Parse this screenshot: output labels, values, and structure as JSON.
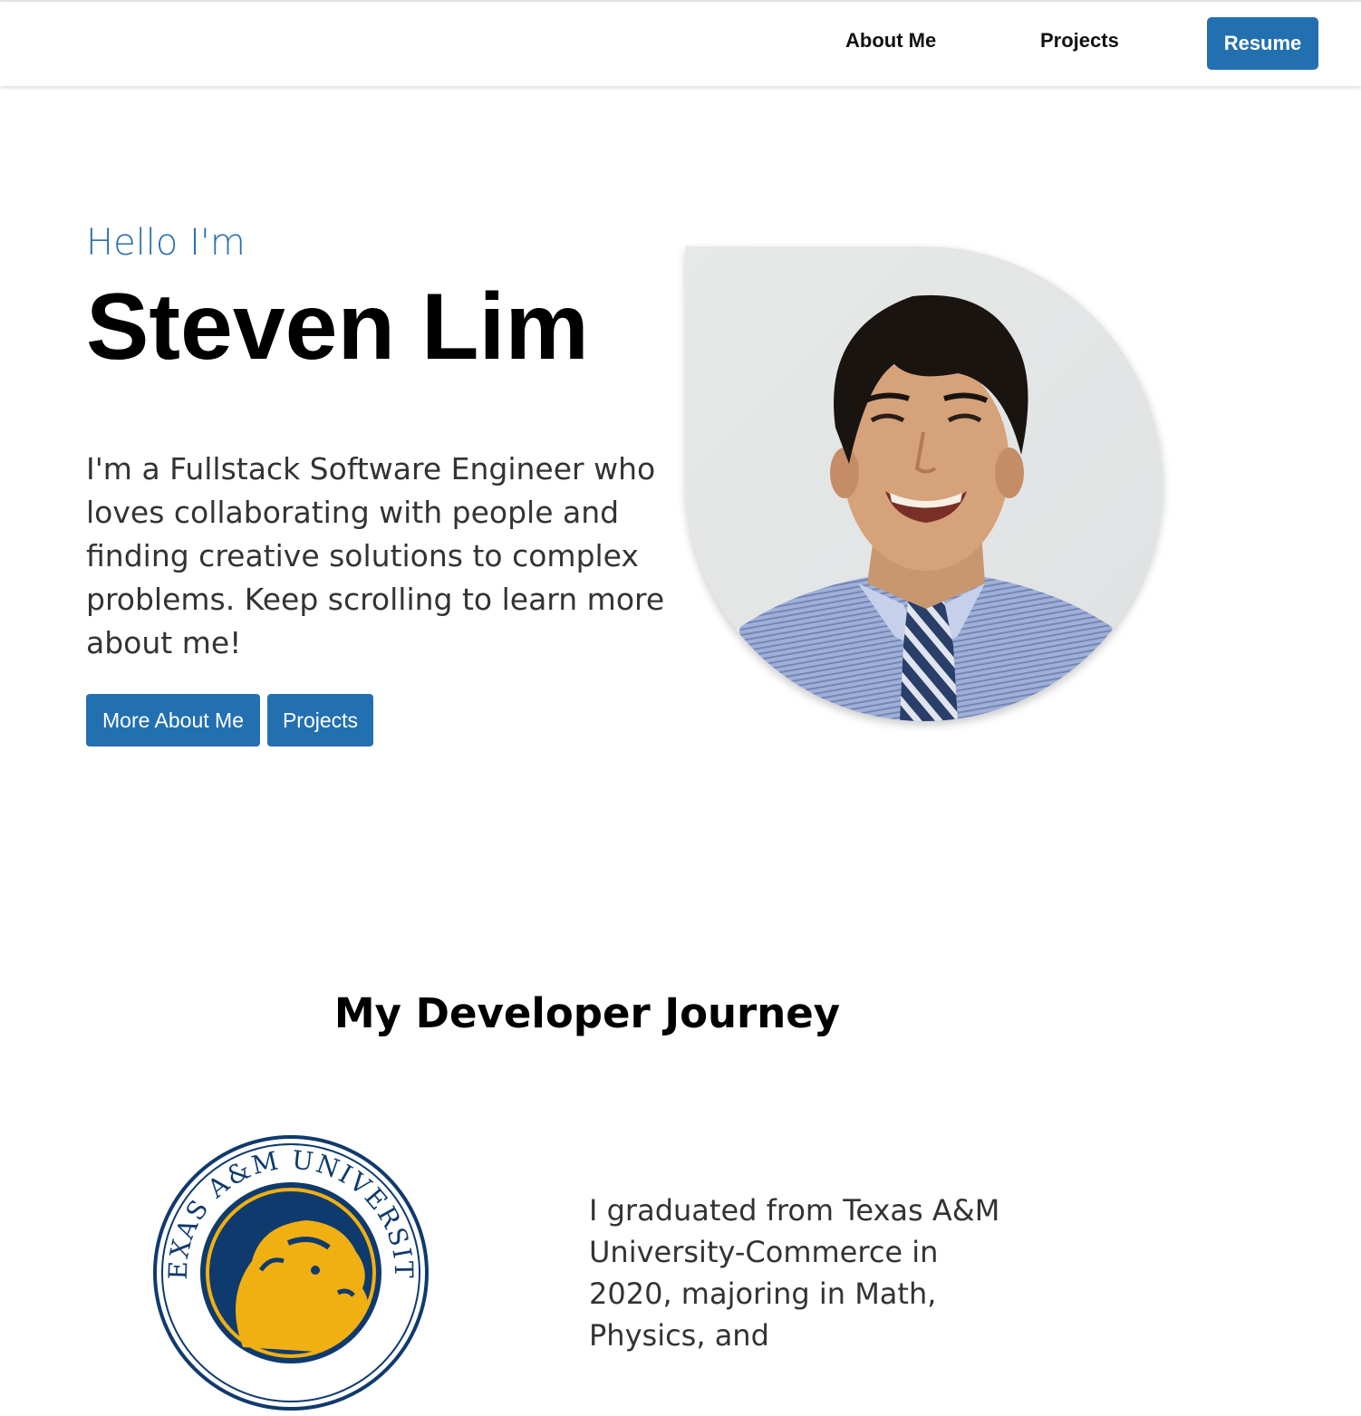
{
  "nav": {
    "about": "About Me",
    "projects": "Projects",
    "resume": "Resume"
  },
  "hero": {
    "greeting": "Hello I'm",
    "name": "Steven Lim",
    "intro": "I'm a Fullstack Software Engineer who loves collaborating with people and finding creative solutions to complex problems. Keep scrolling to learn more about me!",
    "buttons": {
      "more": "More About Me",
      "projects": "Projects"
    }
  },
  "journey": {
    "title": "My Developer Journey",
    "seal_text": "TEXAS A&M UNIVERSITY",
    "paragraph": "I graduated from Texas A&M University-Commerce in 2020, majoring in Math, Physics, and"
  },
  "colors": {
    "accent": "#2370b1",
    "seal_navy": "#0f3a6e",
    "seal_gold": "#f0b011"
  },
  "icons": {
    "portrait": "profile-photo",
    "seal": "university-seal"
  }
}
